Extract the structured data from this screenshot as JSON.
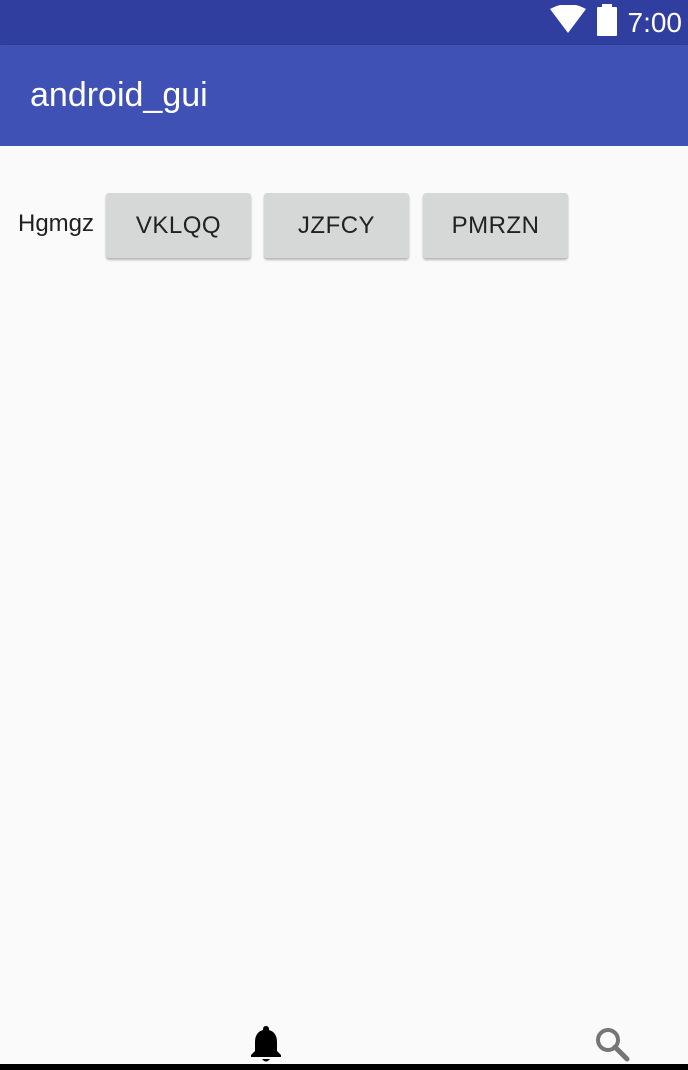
{
  "status_bar": {
    "time": "7:00",
    "icons": [
      "wifi-icon",
      "battery-icon"
    ]
  },
  "app_bar": {
    "title": "android_gui"
  },
  "main": {
    "label": "Hgmgz",
    "buttons": [
      {
        "label": "VKLQQ"
      },
      {
        "label": "JZFCY"
      },
      {
        "label": "PMRZN"
      }
    ]
  },
  "bottom_nav": {
    "icons": [
      "bell-icon",
      "search-icon"
    ]
  },
  "colors": {
    "status_bar": "#303f9f",
    "app_bar": "#3f51b5",
    "background": "#fafafa",
    "button": "#d6d7d7"
  }
}
